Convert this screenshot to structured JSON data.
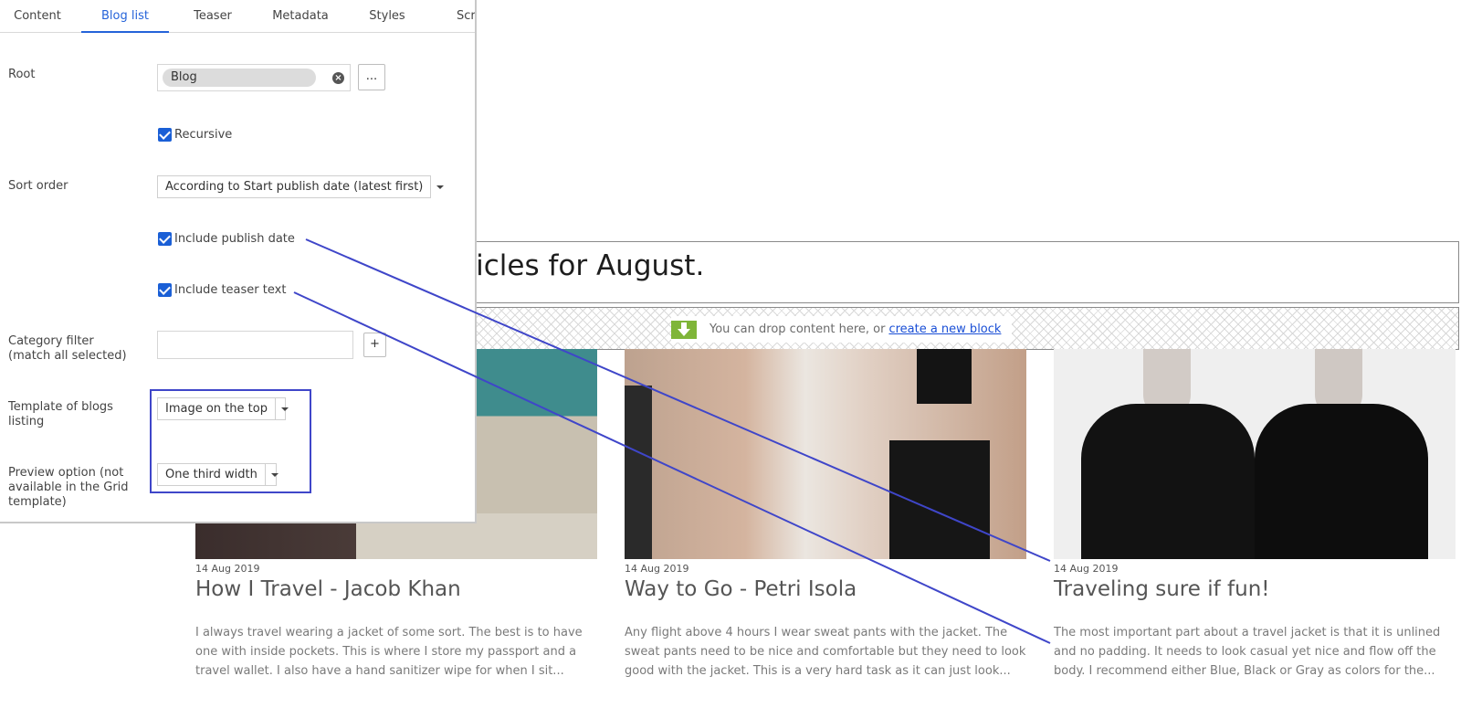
{
  "page": {
    "heading": "ticles for August.",
    "drop_zone": {
      "text": "You can drop content here, or",
      "link": "create a new block",
      "icon": "download-arrow-icon"
    },
    "posts": [
      {
        "date": "14 Aug 2019",
        "title": "How I Travel - Jacob Khan",
        "teaser": "I always travel wearing a jacket of some sort. The best is to have one with inside pockets. This is where I store my passport and a travel wallet. I also have a hand sanitizer wipe for when I sit..."
      },
      {
        "date": "14 Aug 2019",
        "title": "Way to Go - Petri Isola",
        "teaser": "Any flight above 4 hours I wear sweat pants with the jacket. The sweat pants need to be nice and comfortable but they need to look good with the jacket. This is a very hard task as it can just look..."
      },
      {
        "date": "14 Aug 2019",
        "title": "Traveling sure if fun!",
        "teaser": "The most important part about a travel jacket is that it is unlined and no padding. It needs to look casual yet nice and flow off the body. I recommend either Blue, Black or Gray as colors for the..."
      }
    ]
  },
  "dialog": {
    "tabs": [
      "Content",
      "Blog list",
      "Teaser",
      "Metadata",
      "Styles",
      "Scr"
    ],
    "active_tab": "Blog list",
    "root": {
      "label": "Root",
      "value": "Blog",
      "clear_icon": "clear-icon",
      "browse_label": "..."
    },
    "recursive": {
      "label": "Recursive",
      "checked": true
    },
    "sort_order": {
      "label": "Sort order",
      "value": "According to Start publish date (latest first)"
    },
    "include_publish_date": {
      "label": "Include publish date",
      "checked": true
    },
    "include_teaser_text": {
      "label": "Include teaser text",
      "checked": true
    },
    "category_filter": {
      "label": "Category filter (match all selected)",
      "value": "",
      "add_label": "+"
    },
    "template": {
      "label": "Template of blogs listing",
      "value": "Image on the top"
    },
    "preview_option": {
      "label": "Preview option (not available in the Grid template)",
      "value": "One third width"
    }
  },
  "colors": {
    "accent": "#2563d9",
    "checkbox": "#1a5fd6",
    "annotation": "#3f46c9",
    "drop_icon": "#7fb539",
    "link": "#1a4fd6"
  }
}
